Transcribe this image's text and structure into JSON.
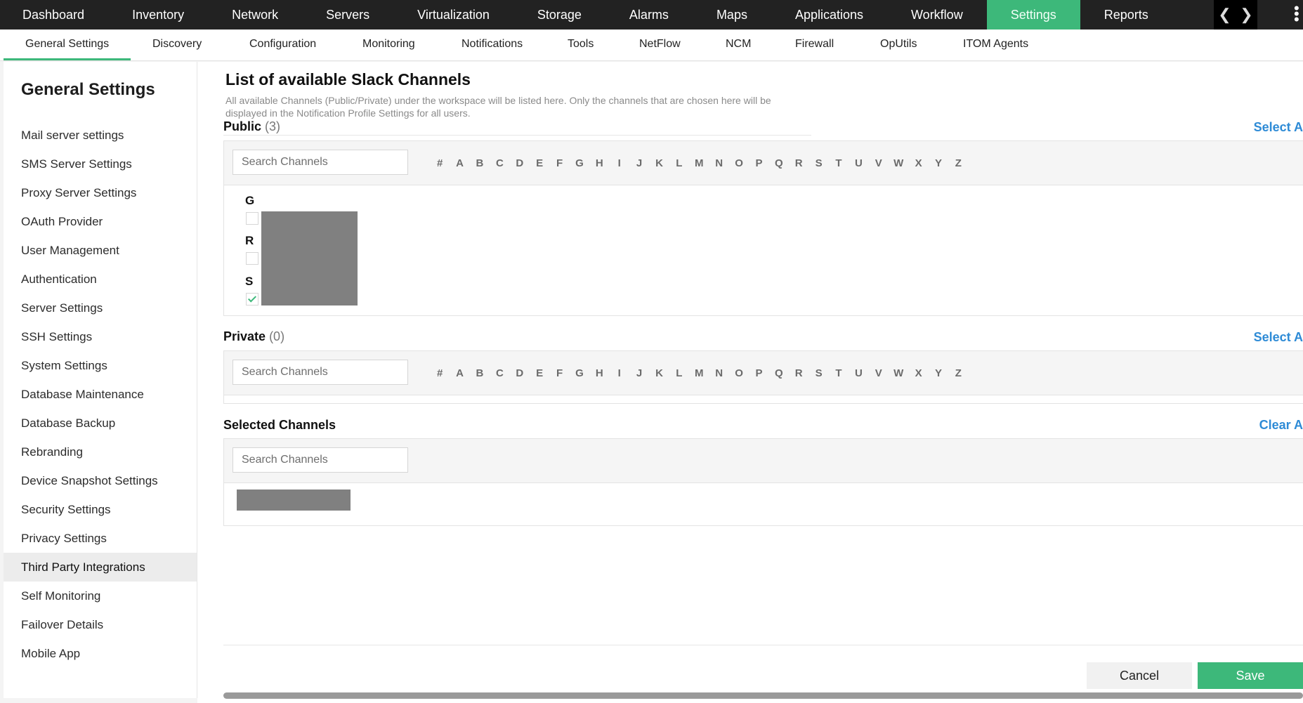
{
  "colors": {
    "accent": "#3db87a",
    "link": "#2e8bd6",
    "topnav_bg": "#222222"
  },
  "topnav": {
    "items": [
      {
        "label": "Dashboard"
      },
      {
        "label": "Inventory"
      },
      {
        "label": "Network"
      },
      {
        "label": "Servers"
      },
      {
        "label": "Virtualization"
      },
      {
        "label": "Storage"
      },
      {
        "label": "Alarms"
      },
      {
        "label": "Maps"
      },
      {
        "label": "Applications"
      },
      {
        "label": "Workflow"
      },
      {
        "label": "Settings"
      },
      {
        "label": "Reports"
      }
    ],
    "active": "Settings",
    "prev_icon": "chevron-left-icon",
    "next_icon": "chevron-right-icon",
    "more_icon": "kebab-menu-icon"
  },
  "subnav": {
    "items": [
      {
        "label": "General Settings"
      },
      {
        "label": "Discovery"
      },
      {
        "label": "Configuration"
      },
      {
        "label": "Monitoring"
      },
      {
        "label": "Notifications"
      },
      {
        "label": "Tools"
      },
      {
        "label": "NetFlow"
      },
      {
        "label": "NCM"
      },
      {
        "label": "Firewall"
      },
      {
        "label": "OpUtils"
      },
      {
        "label": "ITOM Agents"
      }
    ],
    "active": "General Settings"
  },
  "sidebar": {
    "title": "General Settings",
    "items": [
      {
        "label": "Mail server settings"
      },
      {
        "label": "SMS Server Settings"
      },
      {
        "label": "Proxy Server Settings"
      },
      {
        "label": "OAuth Provider"
      },
      {
        "label": "User Management"
      },
      {
        "label": "Authentication"
      },
      {
        "label": "Server Settings"
      },
      {
        "label": "SSH Settings"
      },
      {
        "label": "System Settings"
      },
      {
        "label": "Database Maintenance"
      },
      {
        "label": "Database Backup"
      },
      {
        "label": "Rebranding"
      },
      {
        "label": "Device Snapshot Settings"
      },
      {
        "label": "Security Settings"
      },
      {
        "label": "Privacy Settings"
      },
      {
        "label": "Third Party Integrations"
      },
      {
        "label": "Self Monitoring"
      },
      {
        "label": "Failover Details"
      },
      {
        "label": "Mobile App"
      }
    ],
    "active": "Third Party Integrations"
  },
  "main": {
    "title": "List of available Slack Channels",
    "description": "All available Channels (Public/Private) under the workspace will be listed here. Only the channels that are chosen here will be displayed in the Notification Profile Settings for all users.",
    "alphabet": [
      "#",
      "A",
      "B",
      "C",
      "D",
      "E",
      "F",
      "G",
      "H",
      "I",
      "J",
      "K",
      "L",
      "M",
      "N",
      "O",
      "P",
      "Q",
      "R",
      "S",
      "T",
      "U",
      "V",
      "W",
      "X",
      "Y",
      "Z"
    ],
    "public": {
      "label": "Public",
      "count": "(3)",
      "select_all": "Select A",
      "search_placeholder": "Search Channels",
      "groups": [
        {
          "letter": "G",
          "checked": false
        },
        {
          "letter": "R",
          "checked": false
        },
        {
          "letter": "S",
          "checked": true
        }
      ]
    },
    "private": {
      "label": "Private",
      "count": "(0)",
      "select_all": "Select A",
      "search_placeholder": "Search Channels"
    },
    "selected": {
      "label": "Selected Channels",
      "clear_all": "Clear A",
      "search_placeholder": "Search Channels"
    },
    "cancel_label": "Cancel",
    "save_label": "Save"
  }
}
